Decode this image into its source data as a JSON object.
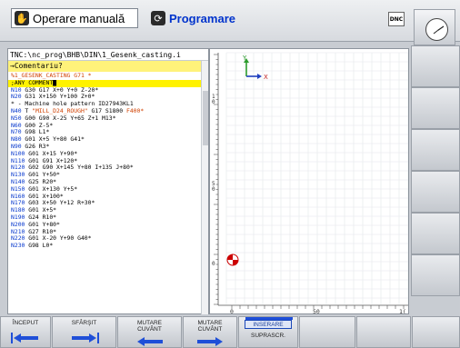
{
  "topbar": {
    "manual_label": "Operare manuală",
    "program_label": "Programare",
    "dnc_label": "DNC"
  },
  "editor": {
    "path": "TNC:\\nc_prog\\BHB\\DIN\\1_Gesenk_casting.i",
    "comment_prompt": "→Comentariu?",
    "lines": [
      {
        "n": "",
        "t": "%1_GESENK_CASTING G71 *",
        "style": "pct"
      },
      {
        "n": "",
        "t": ";ANY COMMENT█",
        "style": "hl"
      },
      {
        "n": "N10",
        "t": " G30 G17 X+0 Y+0 Z-20*"
      },
      {
        "n": "N20",
        "t": " G31 X+150 Y+100 Z+0*"
      },
      {
        "n": "",
        "t": "* - Machine hole pattern ID27943KL1"
      },
      {
        "n": "N40",
        "t": " T ",
        "q": "\"MILL_D24_ROUGH\"",
        "t2": " G17 S1800 ",
        "q2": "F400*"
      },
      {
        "n": "N50",
        "t": " G00 G90 X-25 Y+65 Z+1 M13*"
      },
      {
        "n": "N60",
        "t": " G00 Z-5*"
      },
      {
        "n": "N70",
        "t": " G98 L1*"
      },
      {
        "n": "N80",
        "t": " G01 X+5 Y+80 G41*"
      },
      {
        "n": "N90",
        "t": " G26 R3*"
      },
      {
        "n": "N100",
        "t": " G01 X+15 Y+90*"
      },
      {
        "n": "N110",
        "t": " G01 G91 X+120*"
      },
      {
        "n": "N120",
        "t": " G02 G90 X+145 Y+80 I+135 J+80*"
      },
      {
        "n": "N130",
        "t": " G01 Y+50*"
      },
      {
        "n": "N140",
        "t": " G25 R20*"
      },
      {
        "n": "N150",
        "t": " G01 X+130 Y+5*"
      },
      {
        "n": "N160",
        "t": " G01 X+100*"
      },
      {
        "n": "N170",
        "t": " G03 X+50 Y+12 R+30*"
      },
      {
        "n": "N180",
        "t": " G01 X+5*"
      },
      {
        "n": "N190",
        "t": " G24 R10*"
      },
      {
        "n": "N200",
        "t": " G01 Y+80*"
      },
      {
        "n": "N210",
        "t": " G27 R10*"
      },
      {
        "n": "N220",
        "t": " G01 X-20 Y+90 G40*"
      },
      {
        "n": "N230",
        "t": " G98 L0*"
      }
    ]
  },
  "graphic": {
    "axis_x": "X",
    "axis_y": "Y",
    "ruler_left_labels": [
      "1\n0",
      "5\n0",
      "0"
    ],
    "ruler_bottom_labels": [
      "0",
      "50",
      "1("
    ]
  },
  "softkeys": {
    "inceput": "ÎNCEPUT",
    "sfarsit": "SFÂRŞIT",
    "mutare_cuvant_1": "MUTARE\nCUVÂNT",
    "mutare_cuvant_2": "MUTARE\nCUVÂNT",
    "inserare": "INSERARE",
    "suprascr": "SUPRASCR."
  }
}
